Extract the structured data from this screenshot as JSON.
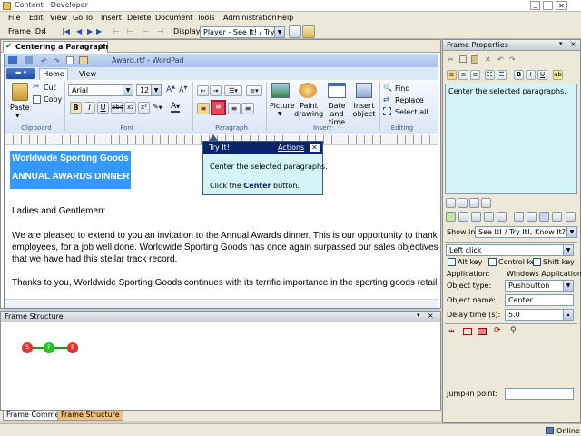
{
  "titlebar": {
    "title": "Content - Developer"
  },
  "menu": [
    "File",
    "Edit",
    "View",
    "Go To",
    "Insert",
    "Delete",
    "Document",
    "Tools",
    "Administration",
    "Help"
  ],
  "toolbar": {
    "frame_id_label": "Frame ID:",
    "frame_id_value": "4",
    "display_label": "Display:",
    "display_value": "Player - See It! / Try It!"
  },
  "doc_tab": {
    "label": "Centering a Paragraph"
  },
  "wordpad": {
    "title": "Award.rtf - WordPad",
    "tabs": [
      "Home",
      "View"
    ],
    "font_name": "Arial",
    "font_size": "12",
    "paste_label": "Paste",
    "cut_label": "Cut",
    "copy_label": "Copy",
    "picture_label": "Picture",
    "paint_label": "Paint drawing",
    "datetime_label": "Date and time",
    "insert_object_label": "Insert object",
    "find_label": "Find",
    "replace_label": "Replace",
    "select_all_label": "Select all",
    "groups": {
      "clipboard": "Clipboard",
      "font": "Font",
      "paragraph": "Paragraph",
      "insert": "Insert",
      "editing": "Editing"
    },
    "document": {
      "line1": "Worldwide Sporting Goods",
      "line2": "ANNUAL AWARDS DINNER",
      "salutation": "Ladies and Gentlemen:",
      "p1_l1": "We are pleased to extend to you an invitation to the Annual Awards dinner.  This is our opportunity to thank y",
      "p1_l2": "employees, for a job well done.  Worldwide Sporting Goods has once again surpassed our sales objectives",
      "p1_l3": "that we have had this stellar track record.",
      "p2_l1": "Thanks to you, Worldwide Sporting Goods continues with its terrific importance in the sporting goods retail i"
    }
  },
  "tryit": {
    "title": "Try It!",
    "actions": "Actions",
    "instruction": "Center the selected paragraphs.",
    "click_prefix": "Click the ",
    "click_target": "Center",
    "click_suffix": " button."
  },
  "frame_structure": {
    "title": "Frame Structure",
    "nodes": [
      "S",
      "F",
      "E"
    ]
  },
  "bottom_tabs": [
    "Frame Comments",
    "Frame Structure"
  ],
  "frame_properties": {
    "title": "Frame Properties",
    "text": "Center the selected paragraphs.",
    "show_in_label": "Show in:",
    "show_in_value": "See It! / Try It!, Know It?, Do It!",
    "action_value": "Left click",
    "alt_key": "Alt key",
    "control_key": "Control key",
    "shift_key": "Shift key",
    "application_label": "Application:",
    "application_value": "Windows Application",
    "object_type_label": "Object type:",
    "object_type_value": "Pushbutton",
    "object_name_label": "Object name:",
    "object_name_value": "Center",
    "delay_label": "Delay time (s):",
    "delay_value": "5.0",
    "jump_in_label": "Jump-in point:"
  },
  "status": {
    "online": "Online"
  },
  "colors": {
    "title_blue": "#0a246a",
    "selection_blue": "#3399ff",
    "tooltip_bg": "#d4f5f8",
    "highlight_red": "#e8465a",
    "tab_orange": "#f5c07a"
  }
}
